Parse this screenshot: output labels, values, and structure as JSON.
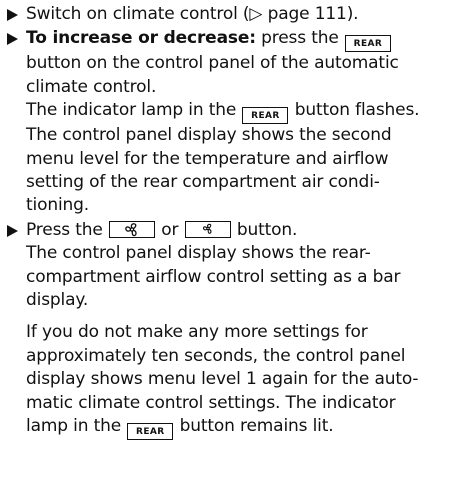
{
  "steps": [
    {
      "lines": [
        "Switch on climate control (▷ page 111)."
      ]
    },
    {
      "bold_lead": "To increase or decrease:",
      "line1_pre": " press the ",
      "line1_post": "",
      "lines": [
        "button on the control panel of the automatic",
        "climate control."
      ],
      "after_pre": "The indicator lamp in the ",
      "after_post": " button flashes.",
      "more_lines": [
        "The control panel display shows the second",
        "menu level for the temperature and airflow",
        "setting of the rear compartment air condi-",
        "tioning."
      ]
    },
    {
      "line1_pre": "Press the ",
      "line1_mid": " or ",
      "line1_post": " button.",
      "lines": [
        "The control panel display shows the rear-",
        "compartment airflow control setting as a bar",
        "display."
      ],
      "note_lines": [
        "If you do not make any more settings for",
        "approximately ten seconds, the control panel",
        "display shows menu level 1 again for the auto-",
        "matic climate control settings. The indicator"
      ],
      "note_last_pre": "lamp in the ",
      "note_last_post": " button remains lit."
    }
  ],
  "keys": {
    "rear": "REAR",
    "fan_increase_icon": "fan-large-icon",
    "fan_decrease_icon": "fan-small-icon"
  }
}
